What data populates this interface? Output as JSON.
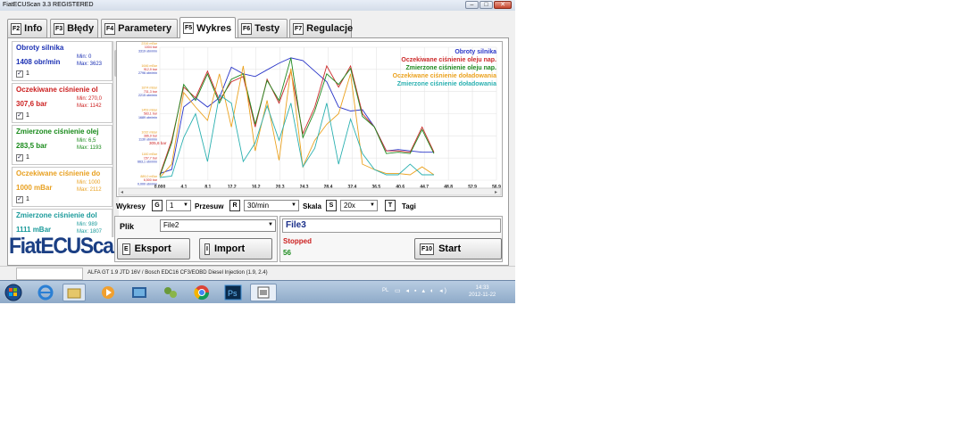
{
  "window": {
    "title": "FiatECUScan 3.3 REGISTERED"
  },
  "tabs": [
    {
      "key": "F2",
      "label": "Info"
    },
    {
      "key": "F3",
      "label": "Błędy"
    },
    {
      "key": "F4",
      "label": "Parametery"
    },
    {
      "key": "F5",
      "label": "Wykres"
    },
    {
      "key": "F6",
      "label": "Testy"
    },
    {
      "key": "F7",
      "label": "Regulacje"
    }
  ],
  "active_tab": "Wykres",
  "params": [
    {
      "name": "Obroty silnika",
      "value": "1408 obr/min",
      "min": "Min: 0",
      "max": "Max: 3623",
      "color": "#1a2fb3",
      "checked": "1"
    },
    {
      "name": "Oczekiwane ciśnienie ol",
      "value": "307,6 bar",
      "min": "Min: 270,0",
      "max": "Max: 1142",
      "color": "#cc1f1f",
      "checked": "1"
    },
    {
      "name": "Zmierzone ciśnienie olej",
      "value": "283,5 bar",
      "min": "Min: 6,5",
      "max": "Max: 1193",
      "color": "#188a1a",
      "checked": "1"
    },
    {
      "name": "Oczekiwane ciśnienie do",
      "value": "1000 mBar",
      "min": "Min: 1000",
      "max": "Max: 2112",
      "color": "#e8a020",
      "checked": "1"
    },
    {
      "name": "Zmierzone ciśnienie dol",
      "value": "1111 mBar",
      "min": "Min: 989",
      "max": "Max: 1807",
      "color": "#1a9a9a",
      "checked": "1"
    }
  ],
  "logo": "FiatECUScan",
  "chart_data": {
    "type": "line",
    "x": [
      0,
      4,
      8.1,
      12.2,
      16.2,
      20.3,
      24.3,
      28.4,
      32.4,
      36.5,
      40.6,
      44.7,
      48.8,
      52.9,
      56.9
    ],
    "x_tick_labels": [
      "0,000",
      "4,1",
      "8,1",
      "12,2",
      "16,2",
      "20,3",
      "24,3",
      "28,4",
      "32,4",
      "36,5",
      "40,6",
      "44,7",
      "48,8",
      "52,9",
      "56,9"
    ],
    "legend": [
      "Obroty silnika",
      "Oczekiwane ciśnienie oleju nap.",
      "Zmierzone ciśnienie oleju nap.",
      "Oczekiwane ciśnienie doładowania",
      "Zmierzone ciśnienie doładowania"
    ],
    "legend_position": "top-right",
    "grid": true,
    "marker_label": "305,6 bar",
    "series": [
      {
        "name": "Obroty silnika",
        "color": "#2a36c8",
        "values": [
          0.05,
          0.08,
          0.55,
          0.62,
          0.55,
          0.62,
          0.85,
          0.8,
          0.78,
          0.83,
          0.88,
          0.92,
          0.9,
          0.82,
          0.74,
          0.55,
          0.52,
          0.53,
          0.4,
          0.22,
          0.23,
          0.22,
          0.21,
          0.21
        ]
      },
      {
        "name": "Oczekiwane ciśnienie oleju nap.",
        "color": "#cc2a2a",
        "values": [
          0.04,
          0.3,
          0.7,
          0.62,
          0.82,
          0.6,
          0.74,
          0.78,
          0.4,
          0.76,
          0.58,
          0.82,
          0.35,
          0.55,
          0.86,
          0.7,
          0.86,
          0.5,
          0.4,
          0.22,
          0.22,
          0.21,
          0.4,
          0.21
        ]
      },
      {
        "name": "Zmierzone ciśnienie oleju nap.",
        "color": "#1f8a1f",
        "values": [
          0.03,
          0.28,
          0.72,
          0.6,
          0.8,
          0.58,
          0.76,
          0.8,
          0.42,
          0.75,
          0.6,
          0.92,
          0.32,
          0.52,
          0.8,
          0.72,
          0.84,
          0.48,
          0.4,
          0.2,
          0.21,
          0.2,
          0.38,
          0.2
        ]
      },
      {
        "name": "Oczekiwane ciśnienie doładowania",
        "color": "#eba21f",
        "values": [
          0.02,
          0.12,
          0.66,
          0.55,
          0.45,
          0.8,
          0.4,
          0.86,
          0.22,
          0.6,
          0.15,
          0.84,
          0.1,
          0.3,
          0.42,
          0.5,
          0.8,
          0.12,
          0.08,
          0.05,
          0.05,
          0.04,
          0.1,
          0.04
        ]
      },
      {
        "name": "Zmierzone ciśnienie doładowania",
        "color": "#2ab0b0",
        "values": [
          0.02,
          0.03,
          0.32,
          0.5,
          0.14,
          0.64,
          0.58,
          0.14,
          0.28,
          0.56,
          0.3,
          0.58,
          0.1,
          0.24,
          0.58,
          0.12,
          0.46,
          0.2,
          0.08,
          0.04,
          0.04,
          0.12,
          0.04,
          0.04
        ]
      }
    ],
    "y_tick_labels": [
      [
        "2316 mBar",
        "1004 bar",
        "3319 obr/min"
      ],
      [
        "1646 mBar",
        "912,9 bar",
        "2796 obr/min"
      ],
      [
        "1874 mBar",
        "731,3 bar",
        "2215 obr/min"
      ],
      [
        "1453 mBar",
        "583,1 bar",
        "1689 obr/min"
      ],
      [
        "1032 mBar",
        "386,9 bar",
        "1130 obr/min"
      ],
      [
        "1160 mBar",
        "157,7 bar",
        "663,1 obr/min"
      ],
      [
        "889,0 mBar",
        "6,500 bar",
        "0,000 obr/min"
      ]
    ]
  },
  "controls": {
    "wykresy_label": "Wykresy",
    "wykresy_key": "G",
    "wykresy_value": "1",
    "przesuw_label": "Przesuw",
    "przesuw_key": "R",
    "przesuw_value": "30/min",
    "skala_label": "Skala",
    "skala_key": "S",
    "skala_value": "20x",
    "tagi_label": "Tagi",
    "tagi_key": "T"
  },
  "file": {
    "label": "Plik",
    "value": "File2",
    "export_key": "E",
    "export_label": "Eksport",
    "import_key": "I",
    "import_label": "Import"
  },
  "session": {
    "file_name": "File3",
    "status": "Stopped",
    "count": "56",
    "start_key": "F10",
    "start_label": "Start"
  },
  "statusbar": {
    "text": "ALFA GT 1.9 JTD 16V / Bosch EDC16 CF3/EOBD Diesel Injection (1.9, 2.4)"
  },
  "taskbar": {
    "lang": "PL",
    "time": "14:33",
    "date": "2012-11-22"
  }
}
